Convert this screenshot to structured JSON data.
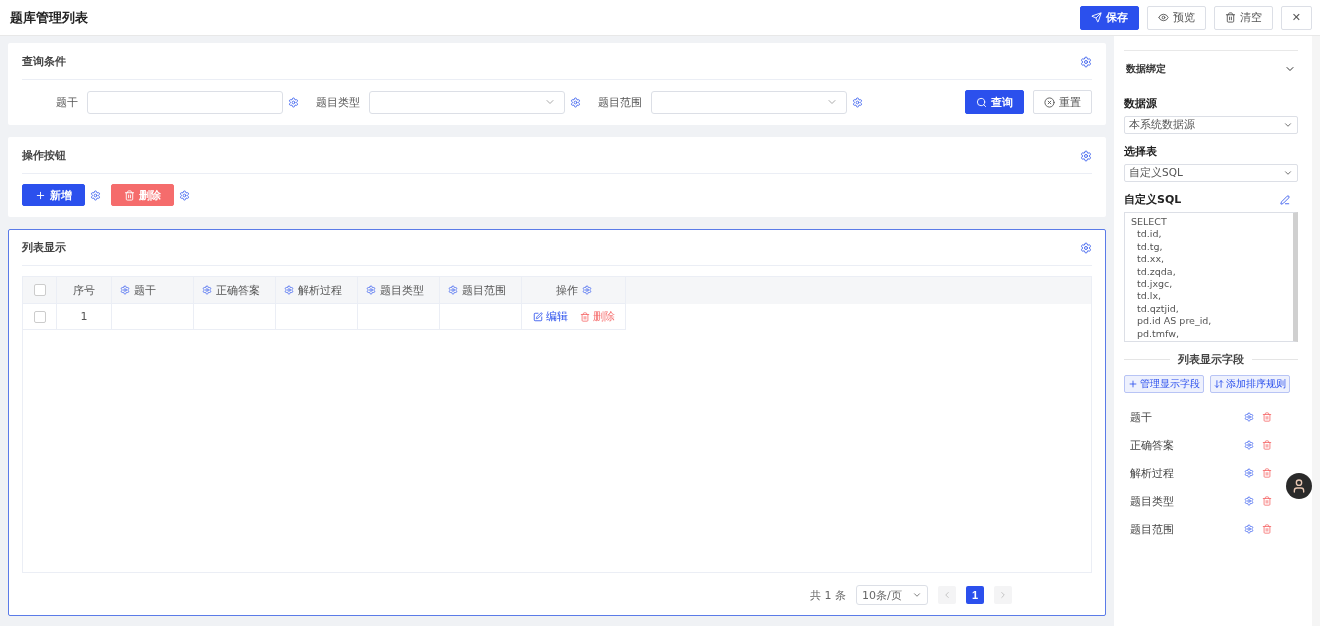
{
  "header": {
    "title": "题库管理列表",
    "buttons": [
      {
        "kind": "primary",
        "label": "保存"
      },
      {
        "kind": "default",
        "label": "预览"
      },
      {
        "kind": "default",
        "label": "清空"
      },
      {
        "kind": "close",
        "label": "✕"
      }
    ]
  },
  "query": {
    "title": "查询条件",
    "fields": [
      {
        "label": "题干",
        "kind": "input"
      },
      {
        "label": "题目类型",
        "kind": "select"
      },
      {
        "label": "题目范围",
        "kind": "select"
      }
    ],
    "search_button": "查询",
    "reset_button": "重置"
  },
  "actions": {
    "title": "操作按钮",
    "buttons": [
      {
        "kind": "primary",
        "label": "新增"
      },
      {
        "kind": "danger",
        "label": "删除"
      }
    ]
  },
  "list": {
    "title": "列表显示",
    "all_checked": false,
    "columns": [
      {
        "label": "序号",
        "gear": false
      },
      {
        "label": "题干",
        "gear": true
      },
      {
        "label": "正确答案",
        "gear": true
      },
      {
        "label": "解析过程",
        "gear": true
      },
      {
        "label": "题目类型",
        "gear": true
      },
      {
        "label": "题目范围",
        "gear": true
      },
      {
        "label": "操作",
        "gear": true
      }
    ],
    "rows": [
      {
        "checked": false,
        "index": "1",
        "edit": "编辑",
        "delete": "删除"
      }
    ],
    "pagination": {
      "total": "共 1 条",
      "page_size": "10条/页",
      "pages": [
        {
          "label": "1",
          "selected": true
        }
      ]
    }
  },
  "panel": {
    "section": "数据绑定",
    "expanded": true,
    "datasource_label": "数据源",
    "datasource": "本系统数据源",
    "table_label": "选择表",
    "table": "自定义SQL",
    "sql_label": "自定义SQL",
    "sql_lines": [
      "SELECT",
      "  td.id,",
      "  td.tg,",
      "  td.xx,",
      "  td.zqda,",
      "  td.jxgc,",
      "  td.lx,",
      "  td.qztjid,",
      "  pd.id AS pre_id,",
      "  pd.tmfw,"
    ],
    "fields_title": "列表显示字段",
    "manage_button": "管理显示字段",
    "sort_button": "添加排序规则",
    "fields": [
      "题干",
      "正确答案",
      "解析过程",
      "题目类型",
      "题目范围"
    ]
  }
}
